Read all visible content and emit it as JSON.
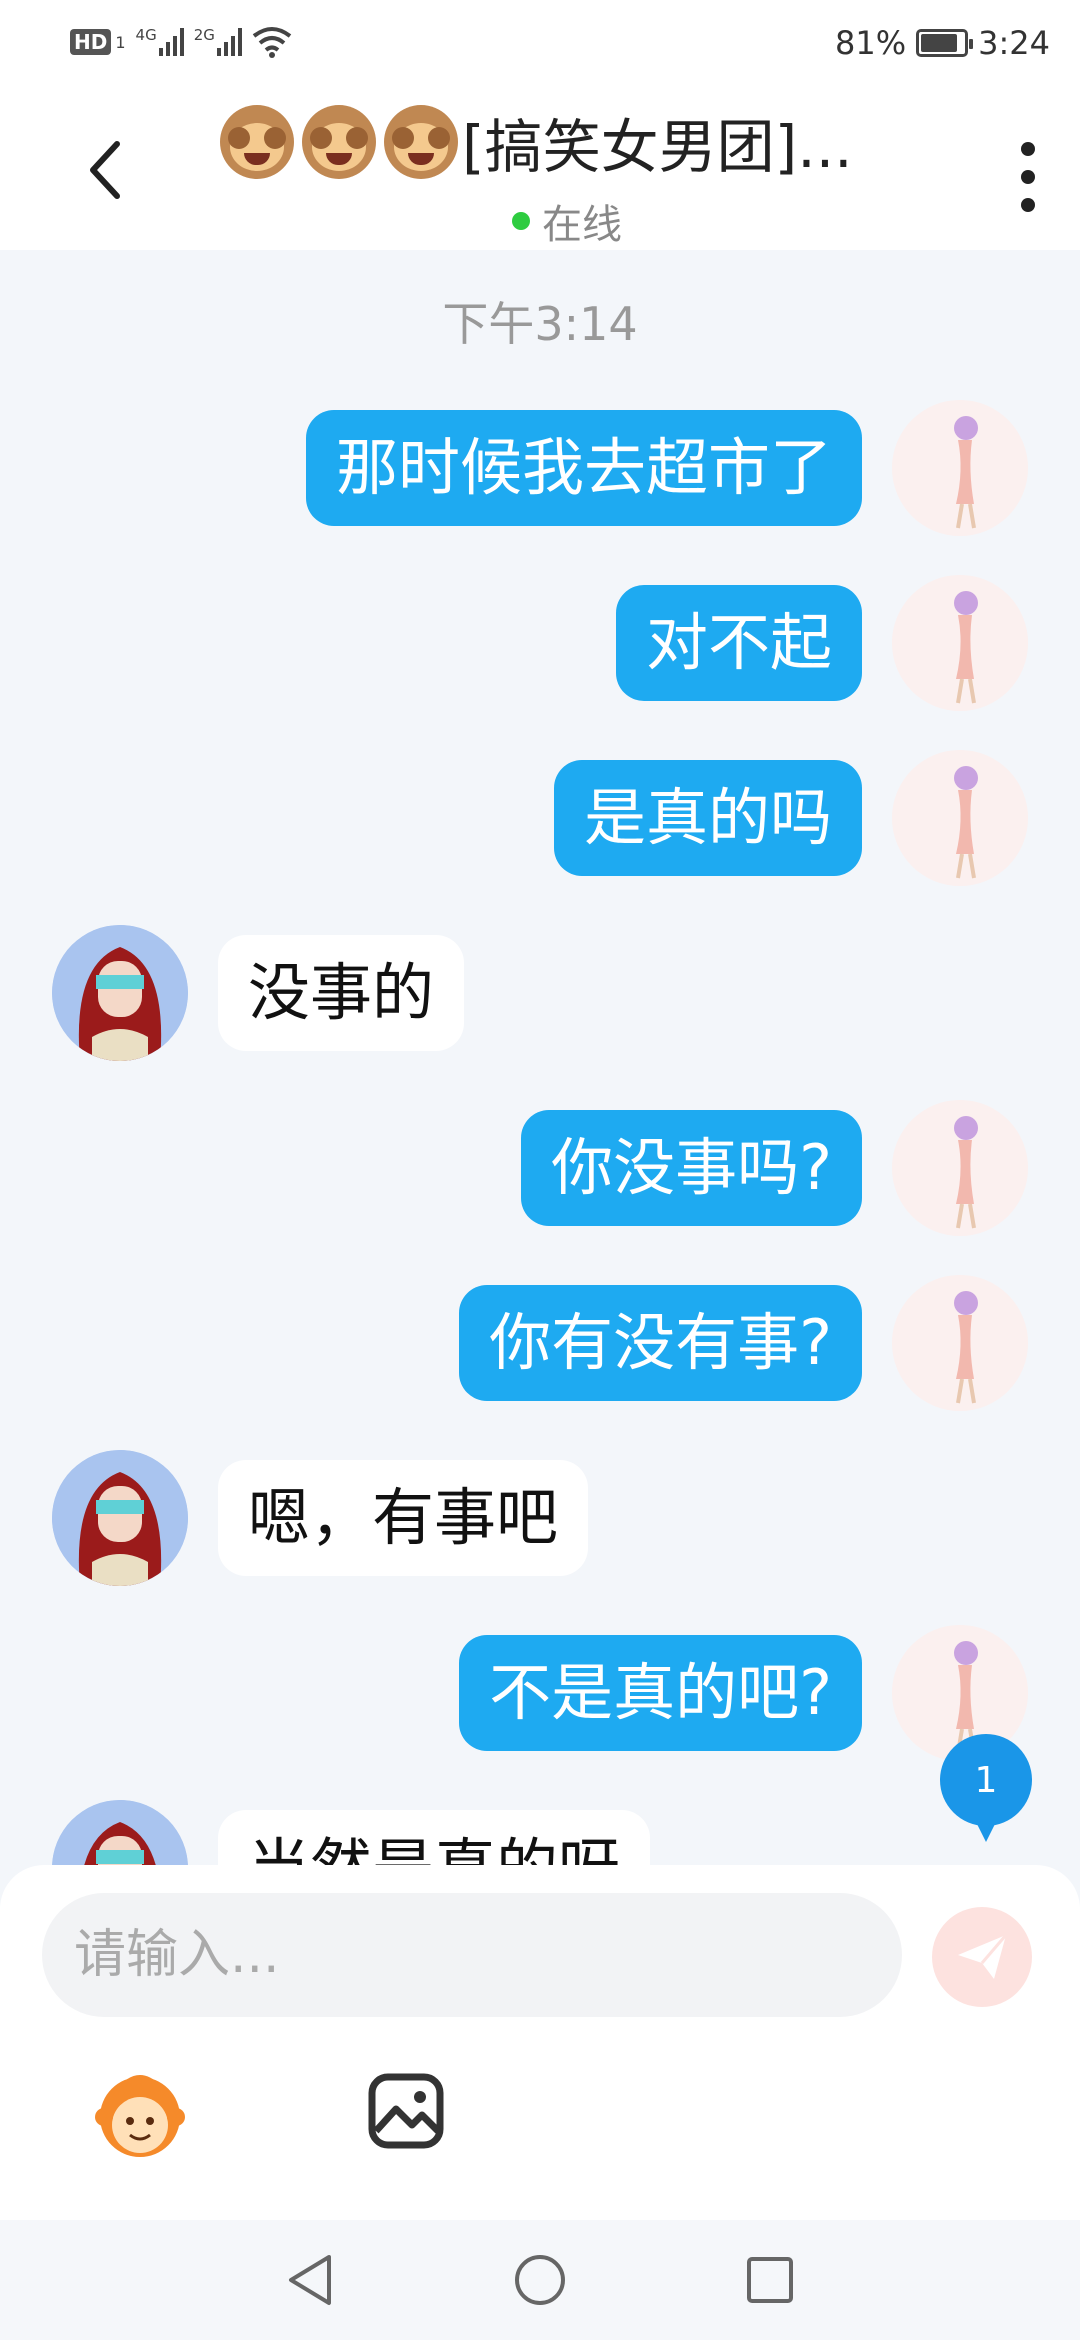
{
  "status_bar": {
    "hd": "HD",
    "sim": "1",
    "net1": "4G",
    "net2": "2G",
    "battery": "81%",
    "battery_level": 0.81,
    "time": "3:24",
    "icons": [
      "wifi-icon",
      "battery-icon"
    ]
  },
  "header": {
    "title": "[搞笑女男团]...",
    "title_emoji_count": 3,
    "status": "在线",
    "back_icon": "chevron-left-icon",
    "more_icon": "more-vertical-icon"
  },
  "chat": {
    "timestamp": "下午3:14",
    "messages": [
      {
        "side": "out",
        "text": "那时候我去超市了"
      },
      {
        "side": "out",
        "text": "对不起"
      },
      {
        "side": "out",
        "text": "是真的吗"
      },
      {
        "side": "in",
        "text": "没事的"
      },
      {
        "side": "out",
        "text": "你没事吗?"
      },
      {
        "side": "out",
        "text": "你有没有事?"
      },
      {
        "side": "in",
        "text": "嗯，有事吧"
      },
      {
        "side": "out",
        "text": "不是真的吧?"
      },
      {
        "side": "in",
        "text": "当然是真的呀"
      }
    ],
    "unread_count": "1"
  },
  "input": {
    "placeholder": "请输入...",
    "send_icon": "send-icon",
    "tools": [
      "emoji-icon",
      "image-icon"
    ]
  },
  "nav": {
    "icons": [
      "back-triangle-icon",
      "home-circle-icon",
      "recents-square-icon"
    ]
  },
  "colors": {
    "out_bubble": "#1eaaf1",
    "in_bubble": "#ffffff",
    "background": "#f3f6fa",
    "online": "#2ecc40",
    "badge": "#1a96e8"
  }
}
